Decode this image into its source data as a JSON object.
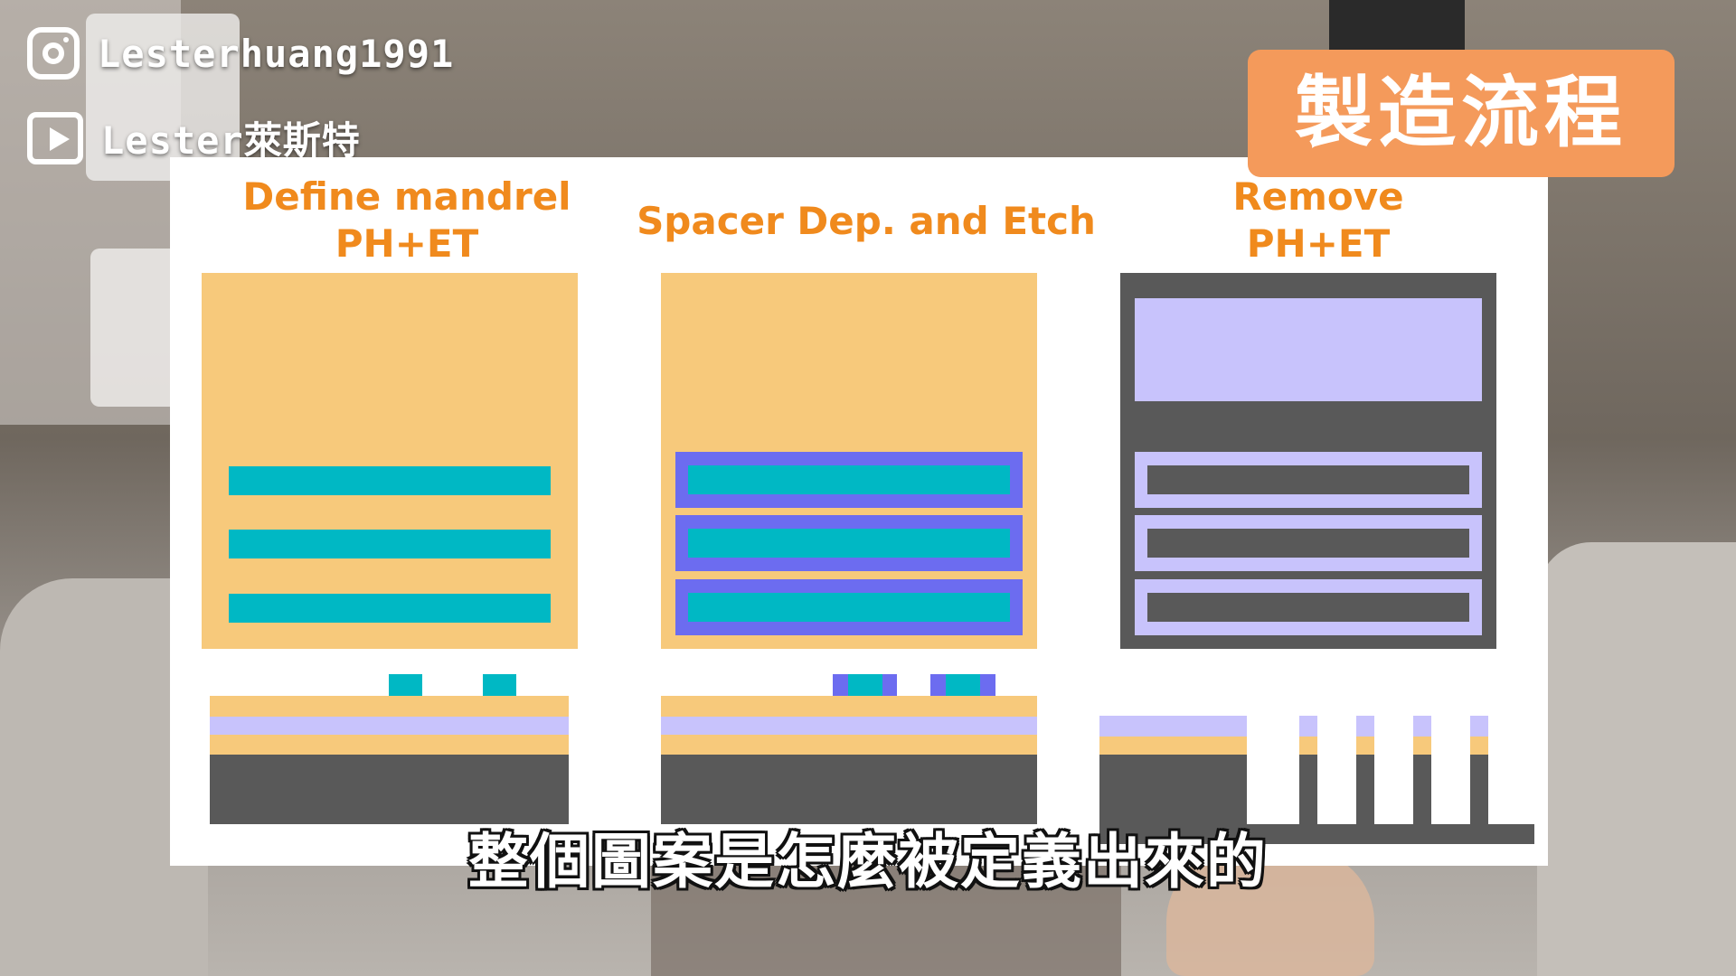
{
  "social": {
    "instagram_handle": "Lesterhuang1991",
    "youtube_handle": "Lester萊斯特"
  },
  "badge": {
    "title": "製造流程"
  },
  "steps": [
    {
      "title_line1": "Define mandrel",
      "title_line2": "PH+ET"
    },
    {
      "title_line1": "Spacer Dep. and Etch"
    },
    {
      "title_line1": "Remove",
      "title_line2": "PH+ET"
    }
  ],
  "subtitle": "整個圖案是怎麼被定義出來的",
  "colors": {
    "photoresist": "#f7c97b",
    "mandrel": "#00b8c4",
    "spacer": "#6c6cf0",
    "hardmask": "#c8c3fc",
    "substrate": "#595959",
    "title_orange": "#f08a1d",
    "badge": "#f49a5b"
  },
  "icons": [
    "instagram-icon",
    "youtube-icon"
  ]
}
